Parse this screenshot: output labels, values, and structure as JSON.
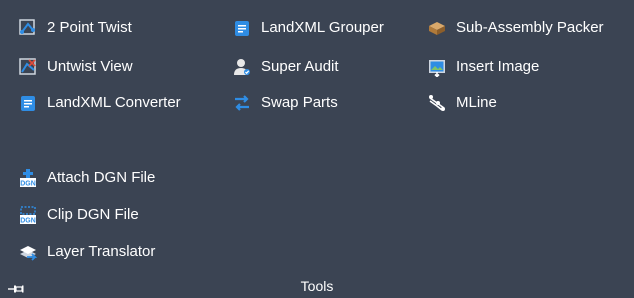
{
  "panel": {
    "title": "Tools",
    "col1": [
      {
        "label": "2 Point Twist",
        "icon": "two-point-twist-icon"
      },
      {
        "label": "Untwist View",
        "icon": "untwist-view-icon"
      },
      {
        "label": "LandXML Converter",
        "icon": "landxml-converter-icon"
      },
      {
        "label": "Attach DGN File",
        "icon": "dgn-icon"
      },
      {
        "label": "Clip DGN File",
        "icon": "dgn-icon"
      },
      {
        "label": "Layer Translator",
        "icon": "layer-translator-icon"
      }
    ],
    "col2": [
      {
        "label": "LandXML Grouper",
        "icon": "landxml-grouper-icon"
      },
      {
        "label": "Super Audit",
        "icon": "super-audit-icon"
      },
      {
        "label": "Swap Parts",
        "icon": "swap-arrows-icon"
      }
    ],
    "col3": [
      {
        "label": "Sub-Assembly Packer",
        "icon": "packer-icon"
      },
      {
        "label": "Insert Image",
        "icon": "insert-image-icon"
      },
      {
        "label": "MLine",
        "icon": "mline-icon"
      }
    ]
  },
  "colors": {
    "background": "#3b4453",
    "text": "#ffffff",
    "accent_blue": "#2f8de4"
  }
}
